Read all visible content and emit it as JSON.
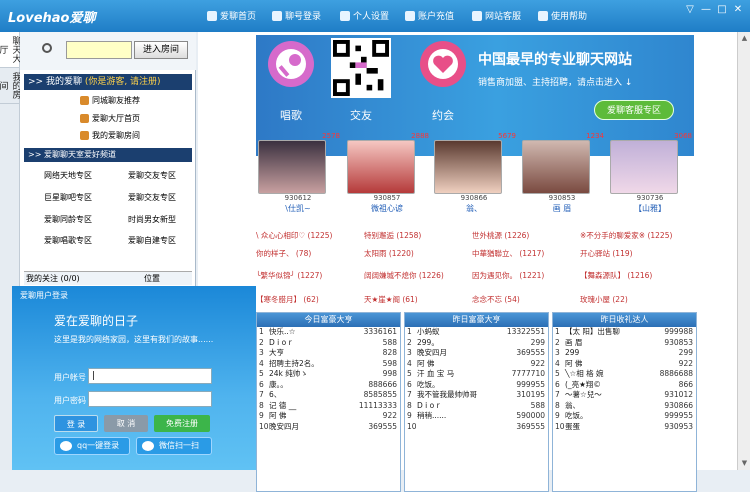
{
  "app": {
    "logo": "Lovehao爱聊"
  },
  "nav": [
    {
      "label": "爱聊首页",
      "icon": "home-icon"
    },
    {
      "label": "聊号登录",
      "icon": "login-icon"
    },
    {
      "label": "个人设置",
      "icon": "settings-icon"
    },
    {
      "label": "账户充值",
      "icon": "recharge-icon"
    },
    {
      "label": "网站客服",
      "icon": "service-icon"
    },
    {
      "label": "使用帮助",
      "icon": "help-icon"
    }
  ],
  "window_controls": [
    "▽",
    "—",
    "□",
    "✕"
  ],
  "vtabs": [
    "聊天大厅",
    "我的房间"
  ],
  "sidebar": {
    "search_button": "进入房间",
    "my_header": ">> 我的爱聊",
    "my_note": "(你是游客, 请注册)",
    "my_items": [
      "同城聊友推荐",
      "爱聊大厅首页",
      "我的爱聊房间"
    ],
    "area_header": ">> 爱聊聊天室爱好频道",
    "zones": [
      "网络天地专区",
      "爱聊交友专区",
      "巨星聊吧专区",
      "爱聊交友专区",
      "爱聊同龄专区",
      "时尚男女新型",
      "爱聊唱歌专区",
      "爱聊自建专区"
    ],
    "follow": "我的关注 (0/0)",
    "position": "位置"
  },
  "banner": {
    "labels": [
      "唱歌",
      "交友",
      "约会"
    ],
    "headline": "中国最早的专业聊天网站",
    "sub": "销售商加盟、主持招聘，请点击进入 ↓",
    "service_button": "爱聊客服专区"
  },
  "profiles": [
    {
      "count": "2578",
      "id": "930612",
      "name": "\\仕凯~"
    },
    {
      "count": "2888",
      "id": "930857",
      "name": "微祖心谚"
    },
    {
      "count": "5679",
      "id": "930866",
      "name": "翁、"
    },
    {
      "count": "1234",
      "id": "930853",
      "name": "画 眉"
    },
    {
      "count": "3068",
      "id": "930736",
      "name": "【山雅】"
    }
  ],
  "room_links": [
    [
      "\\ 众心心相印♡ (1225)",
      "特别邂逅 (1258)",
      "世外桃源 (1226)",
      "※不分手的聊爱家※ (1225)"
    ],
    [
      "你的样子、 (78)",
      "太阳雨 (1220)",
      "中華猶聯立、 (1217)",
      "开心驿站 (119)"
    ],
    [
      "╰繁华似锦╯ (1227)",
      "阔阔嫌城不熄你 (1226)",
      "因为遇见你。 (1221)",
      "【舞森源队】 (1216)"
    ],
    [
      "【寒冬腊月】 (62)",
      "天★崖★阁 (61)",
      "念念不忘 (54)",
      "玫瑰小屋 (22)"
    ]
  ],
  "panels": [
    {
      "title": "今日富豪大亨",
      "rows": [
        [
          "1",
          "快乐..☆",
          "3336161"
        ],
        [
          "2",
          "D i o r",
          "588"
        ],
        [
          "3",
          "大亨",
          "828"
        ],
        [
          "4",
          "招聘主持2名。",
          "598"
        ],
        [
          "5",
          "24k 纯帅ゝ",
          "998"
        ],
        [
          "6",
          "康。。",
          "888666"
        ],
        [
          "7",
          "6、",
          "8585855"
        ],
        [
          "8",
          "记 德 __",
          "11113333"
        ],
        [
          "9",
          "阿 佛",
          "922"
        ],
        [
          "10",
          "晚安四月",
          "369555"
        ]
      ]
    },
    {
      "title": "昨日富豪大亨",
      "rows": [
        [
          "1",
          "小蚂蚁",
          "13322551"
        ],
        [
          "2",
          "299。",
          "299"
        ],
        [
          "3",
          "晚安四月",
          "369555"
        ],
        [
          "4",
          "阿 佛",
          "922"
        ],
        [
          "5",
          "汗 血 宝 马",
          "7777710"
        ],
        [
          "6",
          "吃饭。",
          "999955"
        ],
        [
          "7",
          "我不管我最帅帅哥",
          "310195"
        ],
        [
          "8",
          "D i o r",
          "588"
        ],
        [
          "9",
          "稍稍......",
          "590000"
        ],
        [
          "10",
          "",
          "369555"
        ]
      ]
    },
    {
      "title": "昨日收礼达人",
      "rows": [
        [
          "1",
          "【太 阳】出售聊",
          "999988"
        ],
        [
          "2",
          "画 眉",
          "930853"
        ],
        [
          "3",
          "299",
          "299"
        ],
        [
          "4",
          "阿 佛",
          "922"
        ],
        [
          "5",
          "╲☆相 格 婉",
          "8886688"
        ],
        [
          "6",
          "(_亮★翔©",
          "866"
        ],
        [
          "7",
          "～薯☆兒～",
          "931012"
        ],
        [
          "8",
          "翁、",
          "930866"
        ],
        [
          "9",
          "吃饭。",
          "999955"
        ],
        [
          "10",
          "蛋蛋",
          "930953"
        ]
      ]
    }
  ],
  "login": {
    "title": "爱聊用户登录",
    "headline": "爱在爱聊的日子",
    "sub": "这里是我的网络家园，这里有我们的故事......",
    "account_label": "用户帐号",
    "password_label": "用户密码",
    "account_value": "|",
    "login_button": "登 录",
    "cancel_button": "取 消",
    "register_button": "免费注册",
    "qq_button": "qq一键登录",
    "wechat_button": "微信扫一扫"
  }
}
